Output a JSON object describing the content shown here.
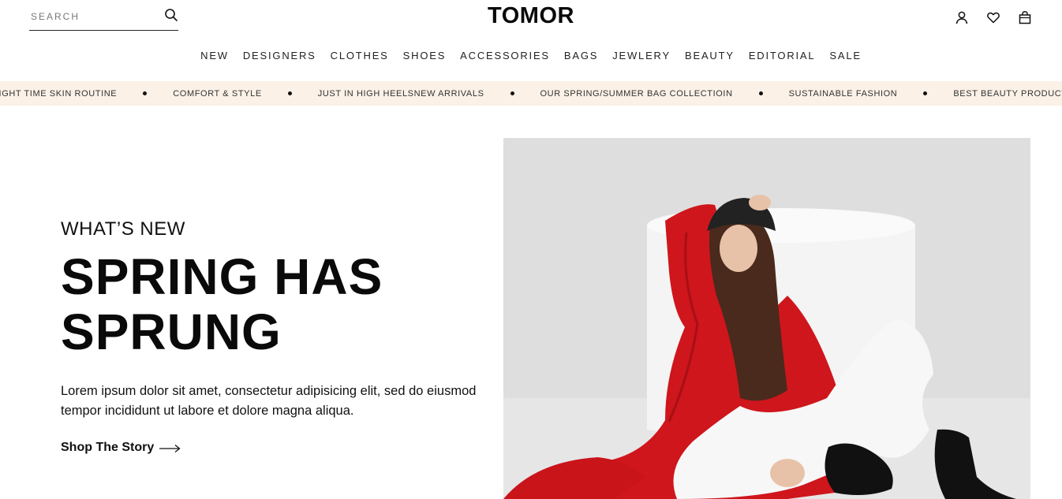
{
  "header": {
    "search_placeholder": "SEARCH",
    "logo": "TOMOR"
  },
  "nav": {
    "items": [
      "NEW",
      "DESIGNERS",
      "CLOTHES",
      "SHOES",
      "ACCESSORIES",
      "BAGS",
      "JEWLERY",
      "BEAUTY",
      "EDITORIAL",
      "SALE"
    ]
  },
  "ticker": {
    "items": [
      "NIGHT TIME SKIN ROUTINE",
      "COMFORT & STYLE",
      "JUST IN HIGH HEELSNEW ARRIVALS",
      "OUR SPRING/SUMMER BAG COLLECTIOIN",
      "SUSTAINABLE FASHION",
      "BEST BEAUTY PRODUCTS"
    ]
  },
  "hero": {
    "eyebrow": "WHAT’S NEW",
    "title_line1": "SPRING HAS",
    "title_line2": "SPRUNG",
    "description": "Lorem ipsum dolor sit amet, consectetur adipisicing elit, sed do eiusmod tempor incididunt ut labore et dolore magna aliqua.",
    "cta_label": "Shop The Story"
  },
  "icons": {
    "search": "search-icon",
    "account": "user-icon",
    "wishlist": "heart-icon",
    "cart": "shopping-bag-icon",
    "cta": "arrow-right-icon"
  },
  "colors": {
    "ticker_bg": "#fbf1e7",
    "text": "#111111",
    "coat_red": "#d0141a"
  }
}
